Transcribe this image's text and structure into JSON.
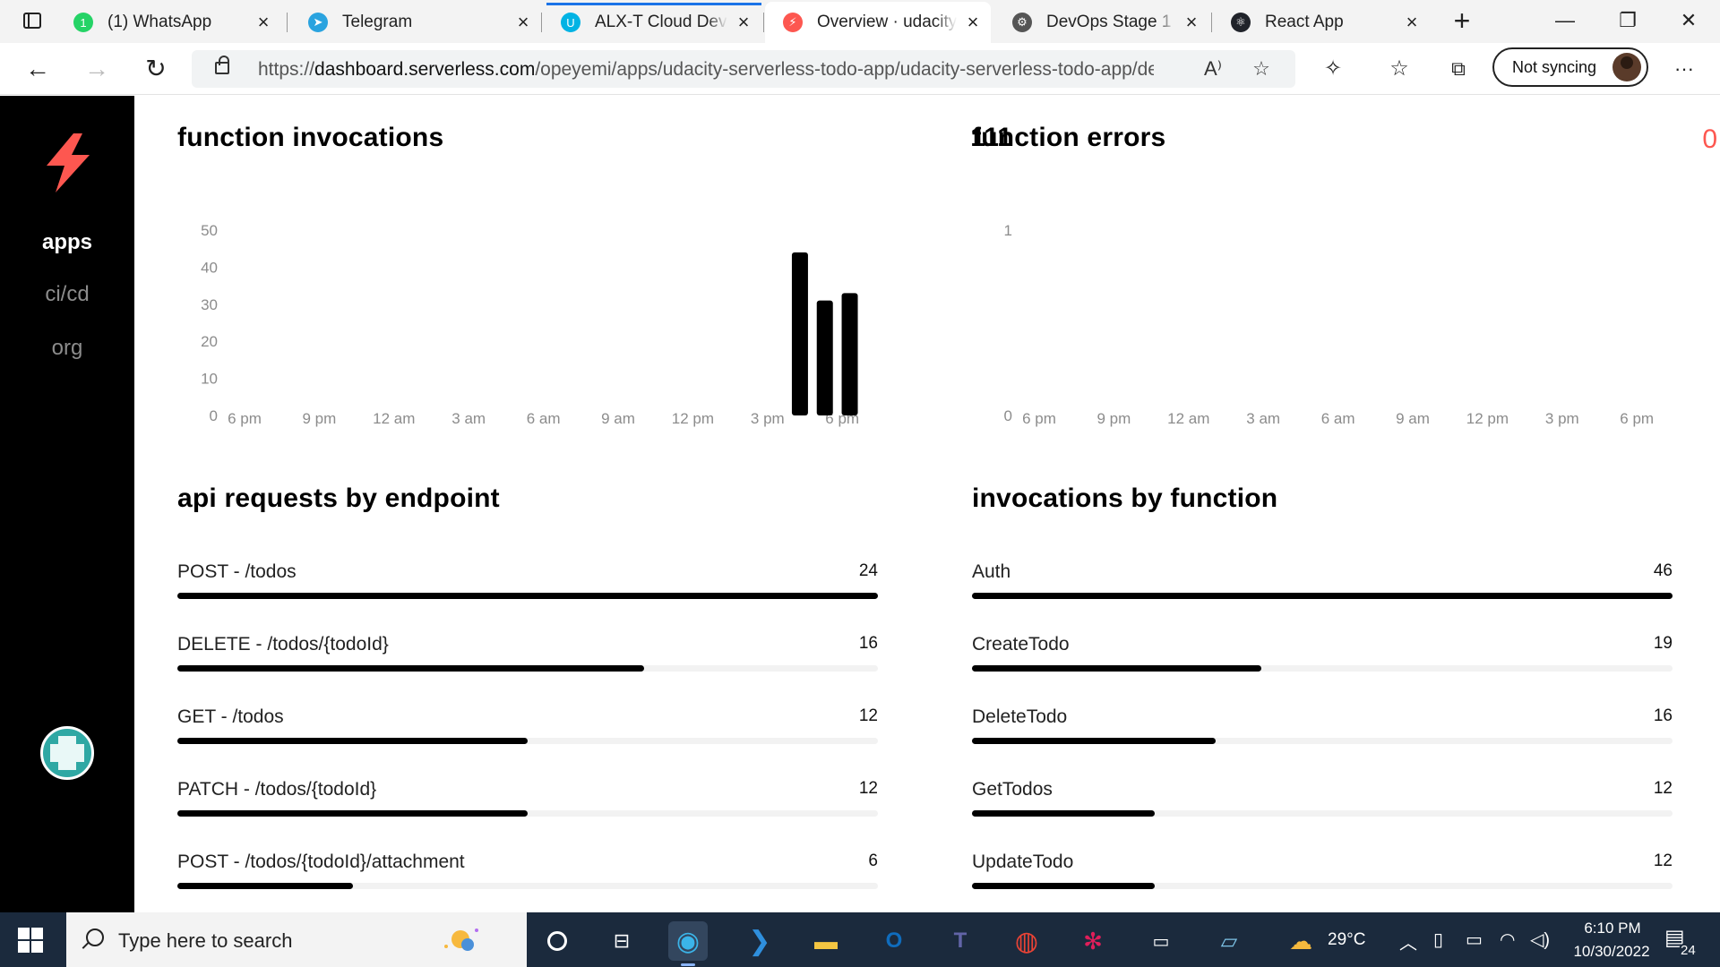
{
  "browser": {
    "tabs": [
      {
        "title": "(1) WhatsApp",
        "fav": "whatsapp-icon",
        "fav_text": "1",
        "fav_color": "#25d366",
        "active": false
      },
      {
        "title": "Telegram",
        "fav": "telegram-icon",
        "fav_text": "➤",
        "fav_color": "#2aa3df",
        "active": false
      },
      {
        "title": "ALX-T Cloud Devel",
        "fav": "udacity-icon",
        "fav_text": "U",
        "fav_color": "#02b3e4",
        "active": false
      },
      {
        "title": "Overview · udacity",
        "fav": "serverless-icon",
        "fav_text": "⚡",
        "fav_color": "#fd5750",
        "active": true
      },
      {
        "title": "DevOps Stage 1 Ta",
        "fav": "gear-icon",
        "fav_text": "⚙",
        "fav_color": "#555555",
        "active": false
      },
      {
        "title": "React App",
        "fav": "react-icon",
        "fav_text": "⚛",
        "fav_color": "#20232a",
        "active": false
      }
    ],
    "url_prefix": "https://",
    "url_host": "dashboard.serverless.com",
    "url_path": "/opeyemi/apps/udacity-serverless-todo-app/udacity-serverless-todo-app/de...",
    "sync_label": "Not syncing"
  },
  "sidebar": {
    "items": [
      {
        "label": "apps",
        "active": true
      },
      {
        "label": "ci/cd",
        "active": false
      },
      {
        "label": "org",
        "active": false
      }
    ]
  },
  "panels": {
    "invocations": {
      "title": "function invocations",
      "total": "111"
    },
    "errors": {
      "title": "function errors",
      "total": "0"
    },
    "endpoints": {
      "title": "api requests by endpoint",
      "rows": [
        {
          "label": "POST - /todos",
          "count": "24",
          "value": 24
        },
        {
          "label": "DELETE - /todos/{todoId}",
          "count": "16",
          "value": 16
        },
        {
          "label": "GET - /todos",
          "count": "12",
          "value": 12
        },
        {
          "label": "PATCH - /todos/{todoId}",
          "count": "12",
          "value": 12
        },
        {
          "label": "POST - /todos/{todoId}/attachment",
          "count": "6",
          "value": 6
        }
      ],
      "max": 24
    },
    "functions": {
      "title": "invocations by function",
      "rows": [
        {
          "label": "Auth",
          "count": "46",
          "value": 46
        },
        {
          "label": "CreateTodo",
          "count": "19",
          "value": 19
        },
        {
          "label": "DeleteTodo",
          "count": "16",
          "value": 16
        },
        {
          "label": "GetTodos",
          "count": "12",
          "value": 12
        },
        {
          "label": "UpdateTodo",
          "count": "12",
          "value": 12
        }
      ],
      "max": 46
    }
  },
  "chart_data": [
    {
      "type": "bar",
      "title": "function invocations",
      "x_ticks": [
        "6 pm",
        "9 pm",
        "12 am",
        "3 am",
        "6 am",
        "9 am",
        "12 pm",
        "3 pm",
        "6 pm"
      ],
      "y_ticks": [
        0,
        10,
        20,
        30,
        40,
        50
      ],
      "ylim": [
        0,
        50
      ],
      "x_range_hours": [
        0,
        24
      ],
      "bars": [
        {
          "hour": 22.3,
          "value": 44
        },
        {
          "hour": 23.3,
          "value": 31
        },
        {
          "hour": 24.3,
          "value": 33
        }
      ]
    },
    {
      "type": "bar",
      "title": "function errors",
      "x_ticks": [
        "6 pm",
        "9 pm",
        "12 am",
        "3 am",
        "6 am",
        "9 am",
        "12 pm",
        "3 pm",
        "6 pm"
      ],
      "y_ticks": [
        0,
        1
      ],
      "ylim": [
        0,
        1
      ],
      "bars": []
    }
  ],
  "taskbar": {
    "search_placeholder": "Type here to search",
    "weather": "29°C",
    "time": "6:10 PM",
    "date": "10/30/2022",
    "notifications": "24"
  }
}
